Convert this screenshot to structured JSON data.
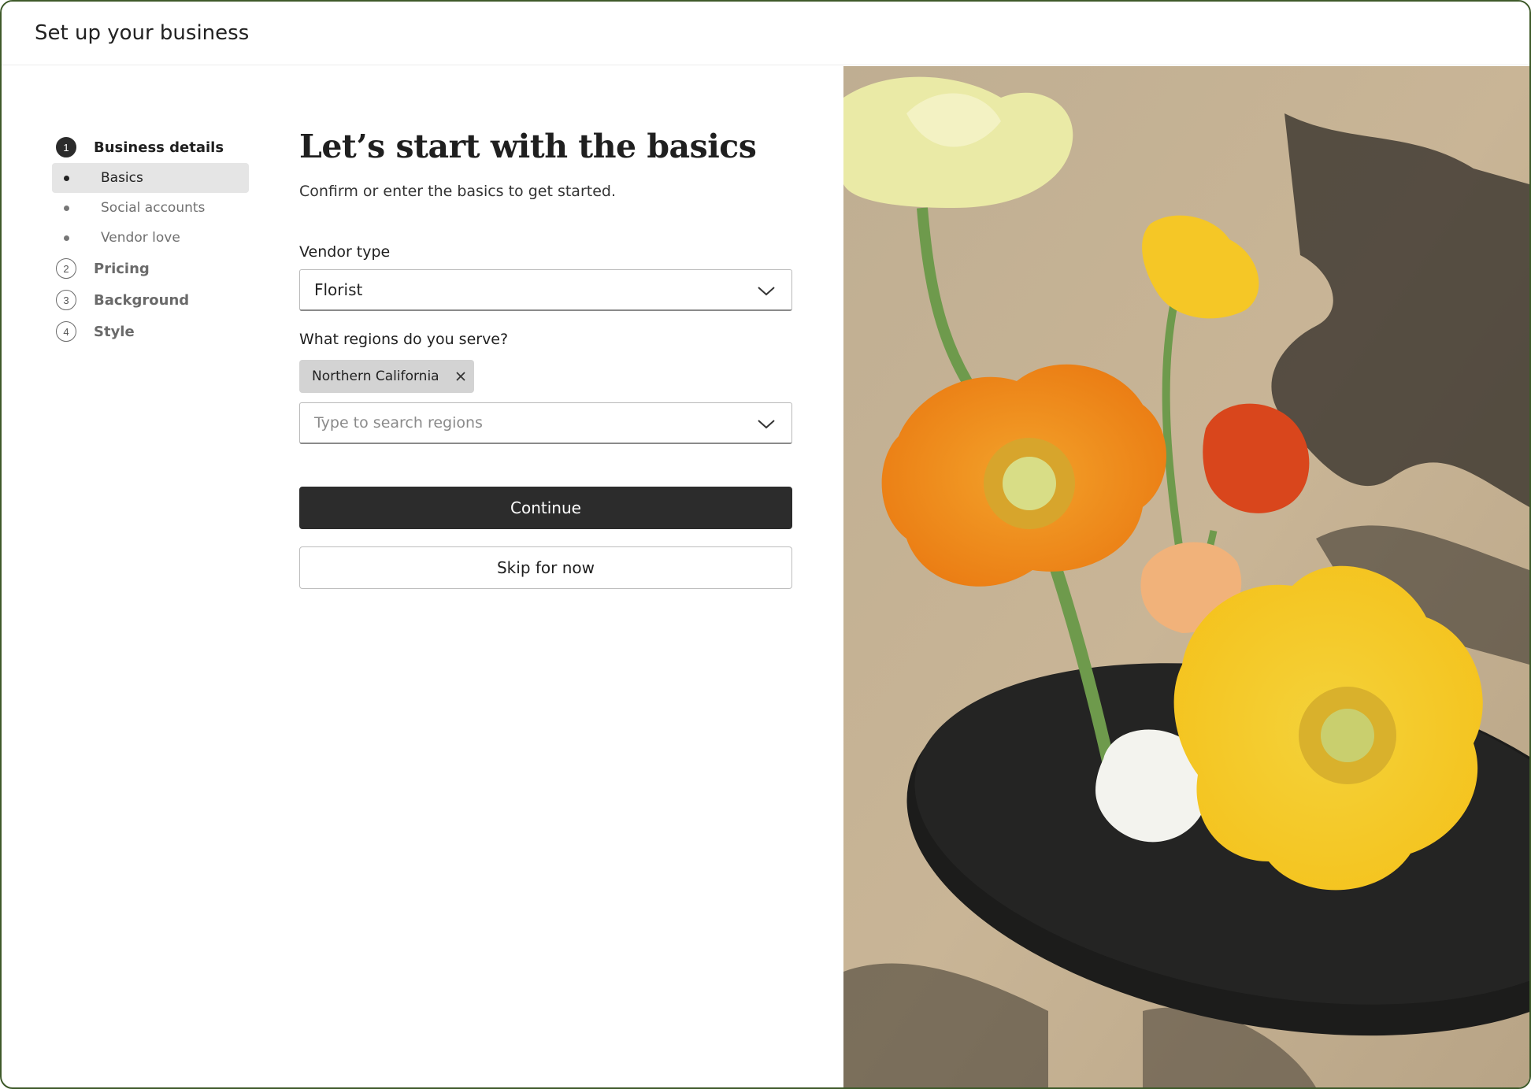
{
  "header": {
    "title": "Set up your business"
  },
  "sidebar": {
    "steps": [
      {
        "number": "1",
        "label": "Business details",
        "active": true,
        "substeps": [
          {
            "label": "Basics",
            "selected": true
          },
          {
            "label": "Social accounts",
            "selected": false
          },
          {
            "label": "Vendor love",
            "selected": false
          }
        ]
      },
      {
        "number": "2",
        "label": "Pricing"
      },
      {
        "number": "3",
        "label": "Background"
      },
      {
        "number": "4",
        "label": "Style"
      }
    ]
  },
  "main": {
    "heading": "Let’s start with the basics",
    "subheading": "Confirm or enter the basics to get started.",
    "vendor_type": {
      "label": "Vendor type",
      "value": "Florist"
    },
    "regions": {
      "label": "What regions do you serve?",
      "selected": [
        "Northern California"
      ],
      "placeholder": "Type to search regions"
    },
    "continue_label": "Continue",
    "skip_label": "Skip for now"
  },
  "colors": {
    "frame_border": "#3e5a2a",
    "primary_button": "#2c2c2c",
    "selected_substep_bg": "#e5e5e5",
    "chip_bg": "#d3d3d3"
  },
  "icons": [
    "chevron-down-icon",
    "close-icon"
  ]
}
